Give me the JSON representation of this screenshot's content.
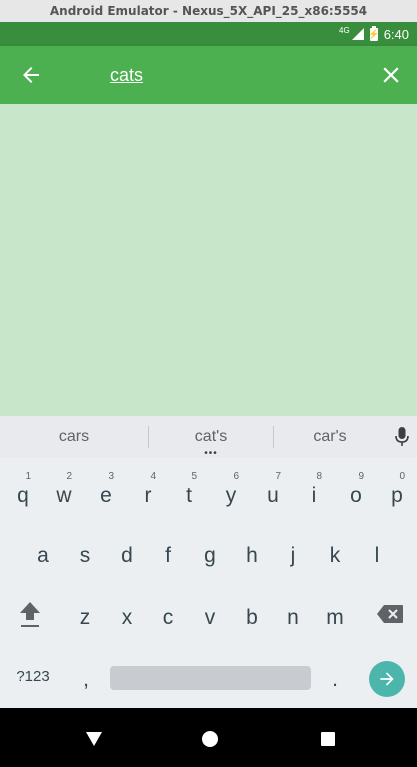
{
  "window": {
    "title": "Android Emulator - Nexus_5X_API_25_x86:5554"
  },
  "status_bar": {
    "network": "4G",
    "time": "6:40"
  },
  "toolbar": {
    "search_value": "cats"
  },
  "suggestions": [
    "cars",
    "cat's",
    "car's"
  ],
  "keyboard": {
    "row1": [
      {
        "key": "q",
        "hint": "1"
      },
      {
        "key": "w",
        "hint": "2"
      },
      {
        "key": "e",
        "hint": "3"
      },
      {
        "key": "r",
        "hint": "4"
      },
      {
        "key": "t",
        "hint": "5"
      },
      {
        "key": "y",
        "hint": "6"
      },
      {
        "key": "u",
        "hint": "7"
      },
      {
        "key": "i",
        "hint": "8"
      },
      {
        "key": "o",
        "hint": "9"
      },
      {
        "key": "p",
        "hint": "0"
      }
    ],
    "row2": [
      "a",
      "s",
      "d",
      "f",
      "g",
      "h",
      "j",
      "k",
      "l"
    ],
    "row3": [
      "z",
      "x",
      "c",
      "v",
      "b",
      "n",
      "m"
    ],
    "symbols_label": "?123",
    "comma": ",",
    "period": "."
  },
  "colors": {
    "primary": "#4caf50",
    "primary_dark": "#388e3c",
    "content_bg": "#c8e6c9",
    "keyboard_bg": "#eceff1",
    "enter_accent": "#4db6ac"
  },
  "icons": {
    "back": "arrow-left-icon",
    "close": "close-icon",
    "mic": "mic-icon",
    "shift": "shift-icon",
    "backspace": "backspace-icon",
    "enter": "arrow-right-icon"
  }
}
